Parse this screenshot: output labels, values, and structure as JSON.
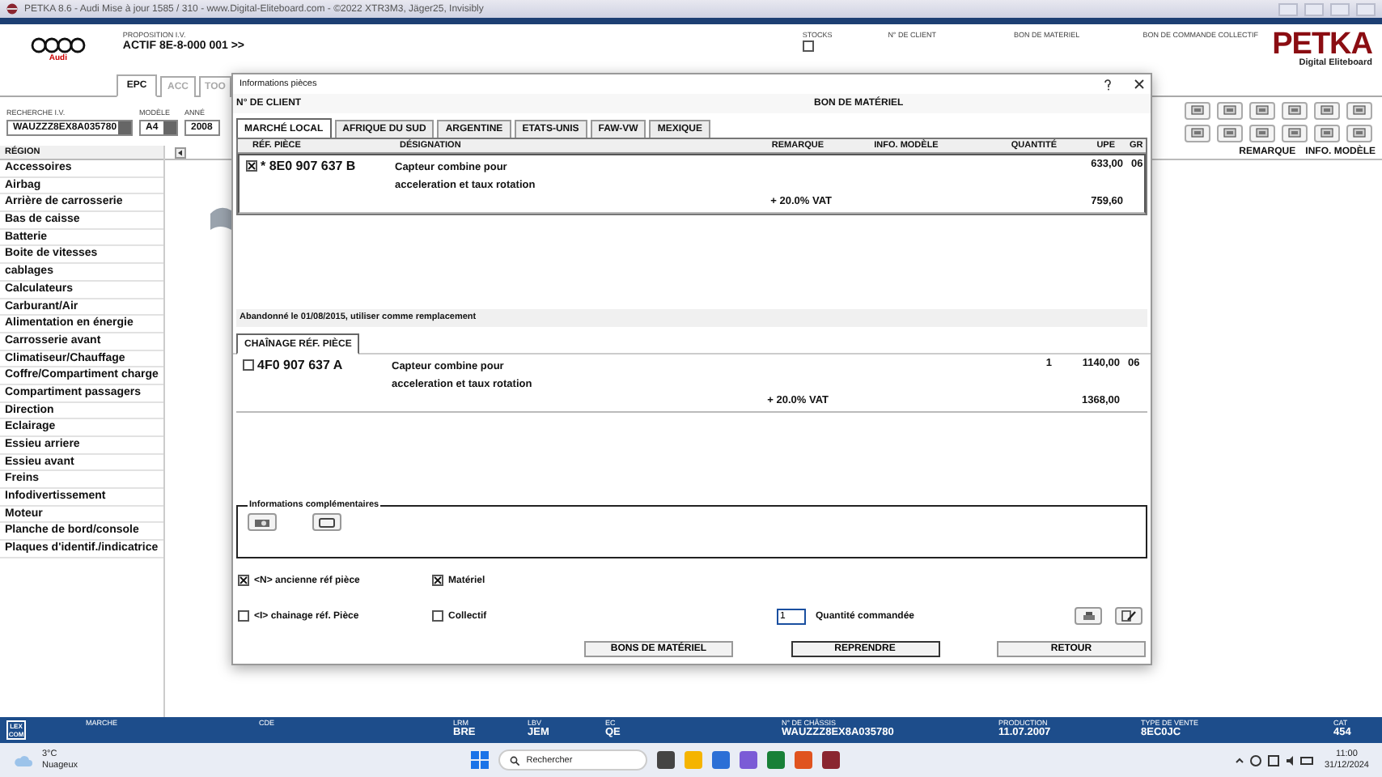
{
  "window": {
    "title": "PETKA 8.6 - Audi Mise à jour 1585 / 310 - www.Digital-Eliteboard.com - ©2022 XTR3M3, Jäger25, Invisibly"
  },
  "header": {
    "brand": "Audi",
    "proposal_label": "PROPOSITION I.V.",
    "proposal_value": "ACTIF  8E-8-000 001 >>",
    "stocks": {
      "label": "STOCKS",
      "checked": false
    },
    "labels": [
      "N° DE CLIENT",
      "BON DE MATERIEL",
      "BON DE COMMANDE COLLECTIF"
    ],
    "logo": {
      "name": "PETKA",
      "tagline": "Digital Eliteboard"
    }
  },
  "tabs": [
    {
      "label": "EPC",
      "selected": true
    },
    {
      "label": "ACC",
      "selected": false
    },
    {
      "label": "TOO",
      "selected": false
    }
  ],
  "search_fields": [
    {
      "label": "RECHERCHE I.V.",
      "value": "WAUZZZ8EX8A035780"
    },
    {
      "label": "MODÈLE",
      "value": "A4"
    },
    {
      "label": "ANNÉ",
      "value": "2008"
    }
  ],
  "sidebar": {
    "header": "RÉGION",
    "items": [
      {
        "label": "Accessoires",
        "selected": false
      },
      {
        "label": "Airbag",
        "selected": false
      },
      {
        "label": "Arrière de carrosserie",
        "selected": false
      },
      {
        "label": "Bas de caisse",
        "selected": false
      },
      {
        "label": "Batterie",
        "selected": false
      },
      {
        "label": "Boite de vitesses",
        "selected": false
      },
      {
        "label": "cablages",
        "selected": false
      },
      {
        "label": "Calculateurs",
        "selected": false
      },
      {
        "label": "Carburant/Air",
        "selected": false
      },
      {
        "label": "Alimentation en énergie",
        "selected": false
      },
      {
        "label": "Carrosserie avant",
        "selected": false
      },
      {
        "label": "Climatiseur/Chauffage",
        "selected": false
      },
      {
        "label": "Coffre/Compartiment charge",
        "selected": false
      },
      {
        "label": "Compartiment passagers",
        "selected": false
      },
      {
        "label": "Direction",
        "selected": false
      },
      {
        "label": "Eclairage",
        "selected": false
      },
      {
        "label": "Essieu arriere",
        "selected": false
      },
      {
        "label": "Essieu avant",
        "selected": false
      },
      {
        "label": "Freins",
        "selected": false
      },
      {
        "label": "Infodivertissement",
        "selected": false
      },
      {
        "label": "Moteur",
        "selected": false
      },
      {
        "label": "Planche de bord/console",
        "selected": false
      },
      {
        "label": "Plaques d'identif./indicatrice",
        "selected": false
      }
    ]
  },
  "main_columns": [
    "REMARQUE",
    "INFO. MODÈLE"
  ],
  "dialog": {
    "title": "Informations pièces",
    "client_label": "N° DE CLIENT",
    "order_label": "BON DE MATÉRIEL",
    "market_tabs": [
      {
        "label": "MARCHÉ LOCAL",
        "selected": true
      },
      {
        "label": "AFRIQUE DU SUD",
        "selected": false
      },
      {
        "label": "ARGENTINE",
        "selected": false
      },
      {
        "label": "ETATS-UNIS",
        "selected": false
      },
      {
        "label": "FAW-VW",
        "selected": false
      },
      {
        "label": "MEXIQUE",
        "selected": false
      }
    ],
    "columns": [
      "RÉF. PIÈCE",
      "DÉSIGNATION",
      "REMARQUE",
      "INFO. MODÈLE",
      "QUANTITÉ",
      "UPE",
      "GR"
    ],
    "parts": [
      {
        "checked": true,
        "ref": "* 8E0 907 637 B",
        "designation_lines": [
          "Capteur combine pour",
          "acceleration et taux rotation"
        ],
        "upe": "633,00",
        "gr": "06",
        "vat_label": "+ 20.0% VAT",
        "vat_total": "759,60"
      }
    ],
    "notice": "Abandonné le 01/08/2015, utiliser comme remplacement",
    "chain_tab": "CHAÎNAGE RÉF. PIÈCE",
    "chain_parts": [
      {
        "checked": false,
        "ref": "4F0 907 637 A",
        "designation_lines": [
          "Capteur combine pour",
          "acceleration et taux rotation"
        ],
        "quantity": "1",
        "upe": "1140,00",
        "gr": "06",
        "vat_label": "+ 20.0% VAT",
        "vat_total": "1368,00"
      }
    ],
    "info_box": {
      "title": "Informations complémentaires"
    },
    "options": [
      {
        "label": "<N> ancienne réf pièce",
        "checked": true
      },
      {
        "label": "Matériel",
        "checked": true
      },
      {
        "label": "<I> chainage réf. Pièce",
        "checked": false
      },
      {
        "label": "Collectif",
        "checked": false
      }
    ],
    "quantity_field": {
      "value": "1",
      "label": "Quantité commandée"
    },
    "buttons": [
      {
        "label": "BONS DE MATÉRIEL",
        "default": false
      },
      {
        "label": "REPRENDRE",
        "default": true
      },
      {
        "label": "RETOUR",
        "default": false
      }
    ]
  },
  "status_bar": {
    "logo": "LEX COM",
    "fields": [
      {
        "label": "MARCHE"
      },
      {
        "label": "CDE"
      },
      {
        "label": "LRM",
        "value": "BRE"
      },
      {
        "label": "LBV",
        "value": "JEM"
      },
      {
        "label": "EC",
        "value": "QE"
      },
      {
        "label": "N° DE CHÂSSIS",
        "value": "WAUZZZ8EX8A035780"
      },
      {
        "label": "PRODUCTION",
        "value": "11.07.2007"
      },
      {
        "label": "TYPE DE VENTE",
        "value": "8EC0JC"
      },
      {
        "label": "CAT",
        "value": "454"
      }
    ]
  },
  "taskbar": {
    "temperature": "3°C",
    "condition": "Nuageux",
    "search_placeholder": "Rechercher",
    "time": "11:00",
    "date": "31/12/2024"
  }
}
